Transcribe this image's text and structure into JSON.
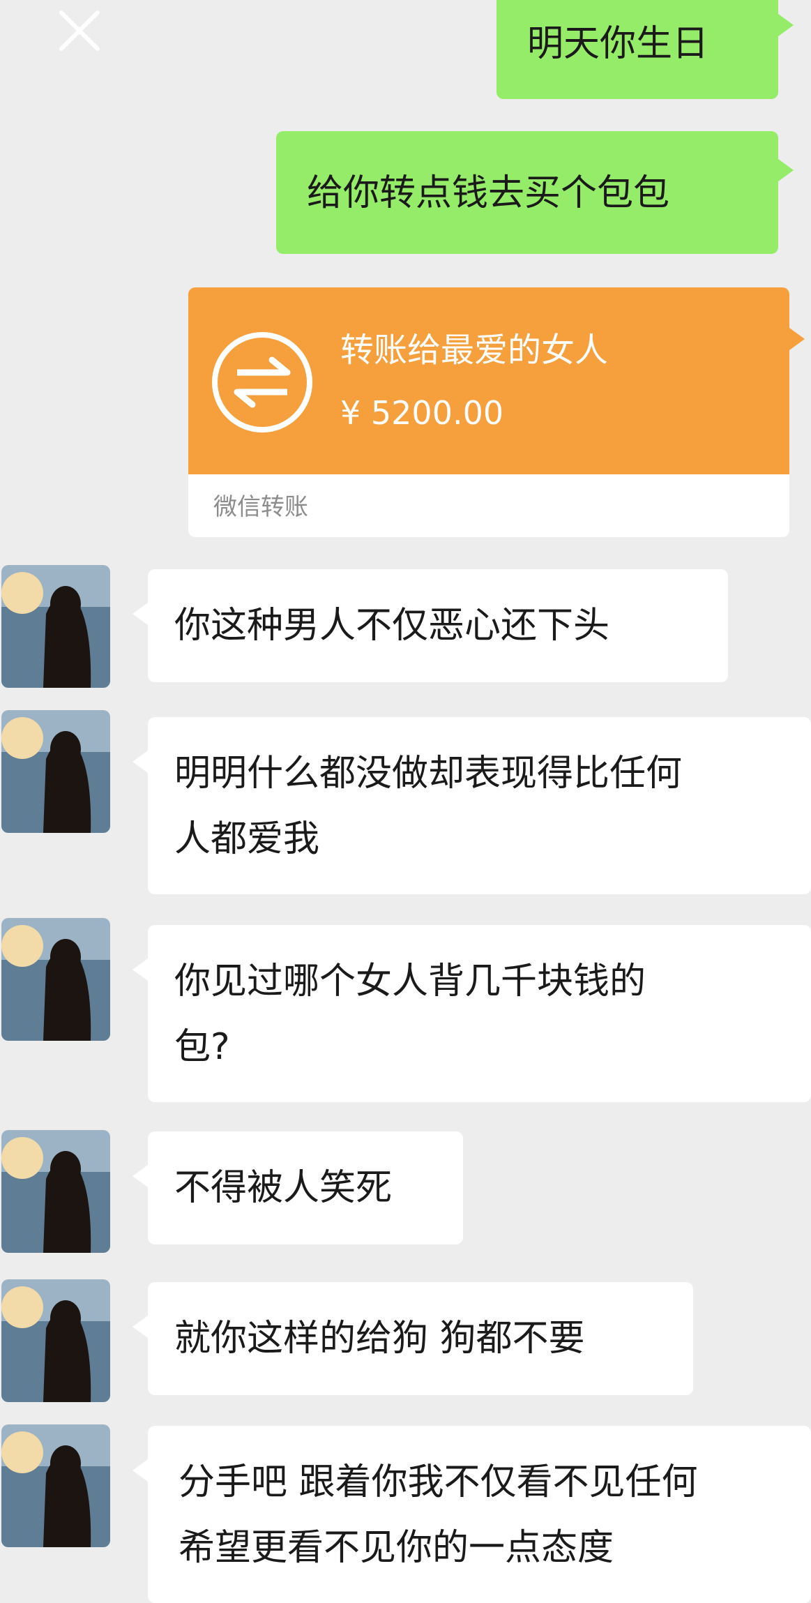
{
  "window": {
    "close_icon": "close-icon"
  },
  "messages": [
    {
      "side": "sent",
      "text": "明天你生日"
    },
    {
      "side": "sent",
      "text": "给你转点钱去买个包包"
    },
    {
      "side": "received",
      "text": "你这种男人不仅恶心还下头"
    },
    {
      "side": "received",
      "text": "明明什么都没做却表现得比任何\n人都爱我"
    },
    {
      "side": "received",
      "text": "你见过哪个女人背几千块钱的\n包?"
    },
    {
      "side": "received",
      "text": "不得被人笑死"
    },
    {
      "side": "received",
      "text": "就你这样的给狗 狗都不要"
    },
    {
      "side": "received",
      "text": "分手吧 跟着你我不仅看不见任何\n希望更看不见你的一点态度"
    }
  ],
  "transfer": {
    "icon": "transfer-arrows-icon",
    "note": "转账给最爱的女人",
    "amount": "¥ 5200.00",
    "footer": "微信转账",
    "color": "#f5a03d"
  },
  "colors": {
    "background": "#ededed",
    "sent_bubble": "#95ec69",
    "received_bubble": "#ffffff"
  }
}
